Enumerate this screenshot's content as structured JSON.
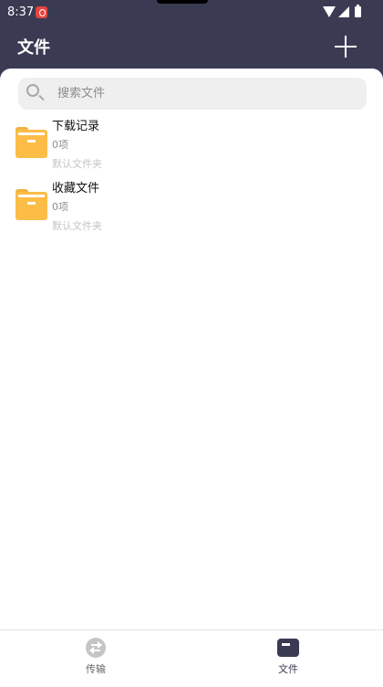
{
  "status_bar": {
    "time": "8:37"
  },
  "header": {
    "title": "文件",
    "add_button_icon": "plus-icon"
  },
  "search": {
    "placeholder": "搜索文件",
    "value": ""
  },
  "files": [
    {
      "name": "下载记录",
      "count": "0项",
      "description": "默认文件夹",
      "icon": "folder-icon"
    },
    {
      "name": "收藏文件",
      "count": "0项",
      "description": "默认文件夹",
      "icon": "folder-icon"
    }
  ],
  "bottom_nav": {
    "tabs": [
      {
        "label": "传输",
        "icon": "transfer-icon",
        "active": false
      },
      {
        "label": "文件",
        "icon": "files-icon",
        "active": true
      }
    ]
  },
  "colors": {
    "header_bg": "#3a3b52",
    "folder": "#fcbd47",
    "inactive_icon": "#c5c5c5"
  }
}
